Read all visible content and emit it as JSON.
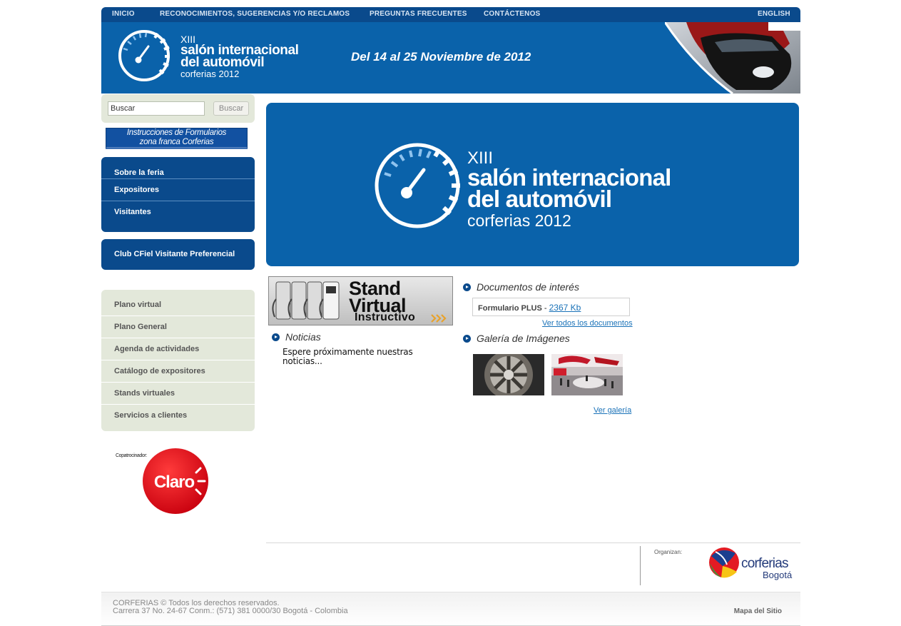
{
  "topnav": {
    "inicio": "INICIO",
    "reclamos": "RECONOCIMIENTOS, SUGERENCIAS Y/O RECLAMOS",
    "preguntas": "PREGUNTAS FRECUENTES",
    "contactenos": "CONTÁCTENOS",
    "english": "ENGLISH"
  },
  "header": {
    "logo": {
      "edition": "XIII",
      "line1": "salón internacional",
      "line2": "del automóvil",
      "line3": "corferias 2012"
    },
    "dates": "Del 14 al 25 Noviembre de 2012"
  },
  "search": {
    "value": "Buscar",
    "button_label": "Buscar"
  },
  "instructions_banner": {
    "line1": "Instrucciones de Formularios",
    "line2": "zona franca Corferias"
  },
  "main_menu": [
    "Sobre la feria",
    "Expositores",
    "Visitantes"
  ],
  "club_label": "Club CFiel Visitante Preferencial",
  "secondary_menu": [
    "Plano virtual",
    "Plano General",
    "Agenda de actividades",
    "Catálogo de expositores",
    "Stands virtuales",
    "Servicios a clientes"
  ],
  "sponsor": {
    "caption": "Copatrocinador:",
    "brand": "Claro"
  },
  "stand_virtual": {
    "line1": "Stand",
    "line2": "Virtual",
    "line3": "Instructivo"
  },
  "noticias": {
    "title": "Noticias",
    "text": "Espere próximamente nuestras noticias..."
  },
  "documentos": {
    "title": "Documentos de interés",
    "doc_name": "Formulario PLUS",
    "separator": " - ",
    "doc_size": "2367 Kb",
    "view_all": "Ver todos los documentos"
  },
  "galeria": {
    "title": "Galería de Imágenes",
    "view_link": "Ver galería"
  },
  "organizer": {
    "label": "Organizan:",
    "brand_line1": "corferias",
    "brand_line2": "Bogotá"
  },
  "footer": {
    "copyright": "CORFERIAS © Todos los derechos reservados.",
    "address": "Carrera 37 No. 24-67 Conm.: (571) 381 0000/30 Bogotá - Colombia",
    "sitemap": "Mapa del Sitio"
  },
  "colors": {
    "brand_blue": "#0a62aa",
    "nav_blue": "#0a4a8c",
    "menu_grey": "#e3e8da",
    "link_blue": "#1a72b8",
    "claro_red": "#e30613"
  }
}
